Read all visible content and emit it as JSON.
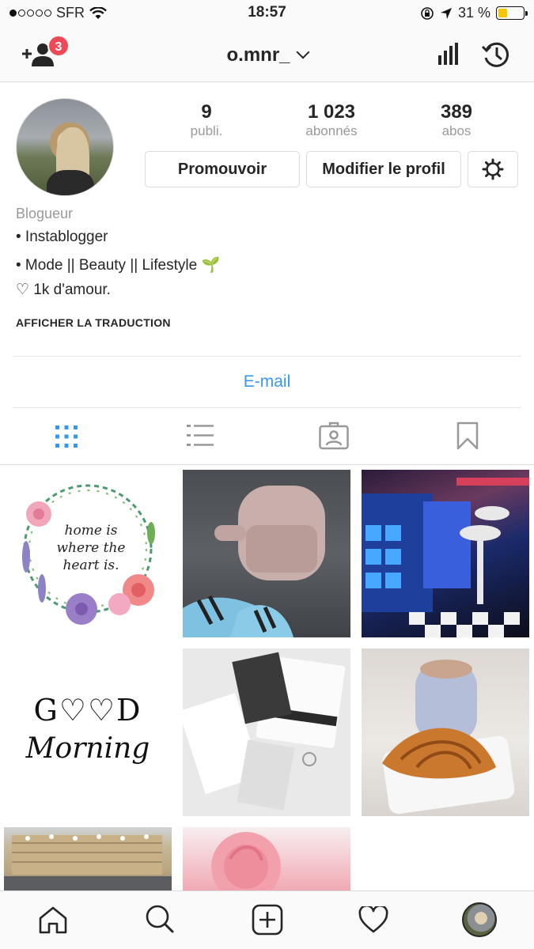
{
  "status_bar": {
    "carrier": "SFR",
    "time": "18:57",
    "battery": "31 %",
    "battery_level": 0.31
  },
  "nav": {
    "username": "o.mnr_",
    "notification_count": "3"
  },
  "profile": {
    "stats": [
      {
        "value": "9",
        "label": "publi."
      },
      {
        "value": "1 023",
        "label": "abonnés"
      },
      {
        "value": "389",
        "label": "abos"
      }
    ],
    "promote_label": "Promouvoir",
    "edit_label": "Modifier le profil",
    "category": "Blogueur",
    "bio_lines": [
      "• Instablogger",
      "• Mode || Beauty || Lifestyle 🌱",
      "♡ 1k d'amour."
    ],
    "translate_label": "AFFICHER LA TRADUCTION",
    "email_label": "E-mail"
  },
  "posts": {
    "c1_text": [
      "home is",
      "where the",
      "heart is."
    ],
    "c4_text": [
      "G♡♡D",
      "Morning"
    ]
  },
  "colors": {
    "accent": "#3897f0",
    "badge": "#ed4956",
    "text": "#262626",
    "muted": "#999999"
  },
  "icons": {
    "nav": [
      "add-person-icon",
      "chevron-down-icon",
      "stats-icon",
      "history-icon"
    ],
    "tabs": [
      "grid-icon",
      "list-icon",
      "tagged-icon",
      "bookmark-icon"
    ],
    "tabbar": [
      "home-icon",
      "search-icon",
      "add-icon",
      "heart-icon",
      "profile-avatar"
    ]
  }
}
